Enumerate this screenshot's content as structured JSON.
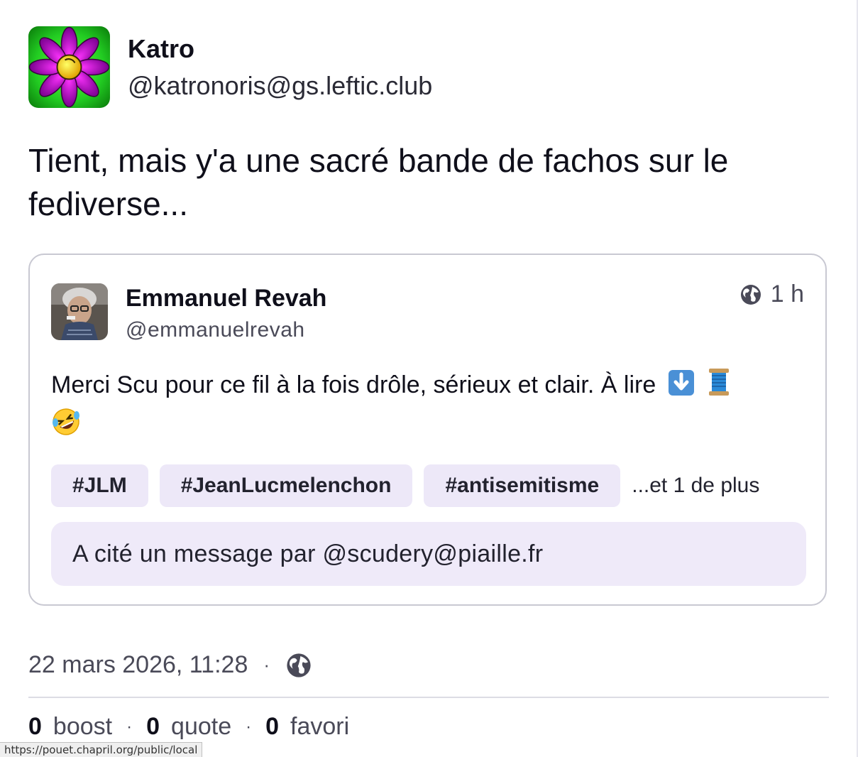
{
  "author": {
    "display_name": "Katro",
    "handle": "@katronoris@gs.leftic.club",
    "avatar_icon": "purple-flower-icon"
  },
  "post": {
    "text": "Tient, mais y'a une sacré bande de fachos sur le fediverse..."
  },
  "quote": {
    "display_name": "Emmanuel Revah",
    "handle": "@emmanuelrevah",
    "visibility_icon": "globe-icon",
    "time": "1 h",
    "text": "Merci Scu pour ce fil à la fois drôle, sérieux et clair. À lire",
    "emojis": [
      "down-arrow-emoji",
      "thread-spool-emoji",
      "rolling-laughing-emoji"
    ],
    "tags": [
      "#JLM",
      "#JeanLucmelenchon",
      "#antisemitisme"
    ],
    "tags_more": "...et 1 de plus",
    "quoted_ref": "A cité un message par @scudery@piaille.fr"
  },
  "meta": {
    "timestamp": "22 mars 2026, 11:28",
    "separator": "·",
    "visibility_icon": "globe-icon"
  },
  "stats": {
    "boost_count": "0",
    "boost_label": "boost",
    "quote_count": "0",
    "quote_label": "quote",
    "favori_count": "0",
    "favori_label": "favori",
    "separator": "·"
  },
  "status_bar": {
    "url": "https://pouet.chapril.org/public/local"
  },
  "colors": {
    "tag_bg": "#ede8f8",
    "card_border": "#c8c8d2",
    "avatar_green": "#22cc22",
    "flower_magenta": "#cc00cc"
  }
}
